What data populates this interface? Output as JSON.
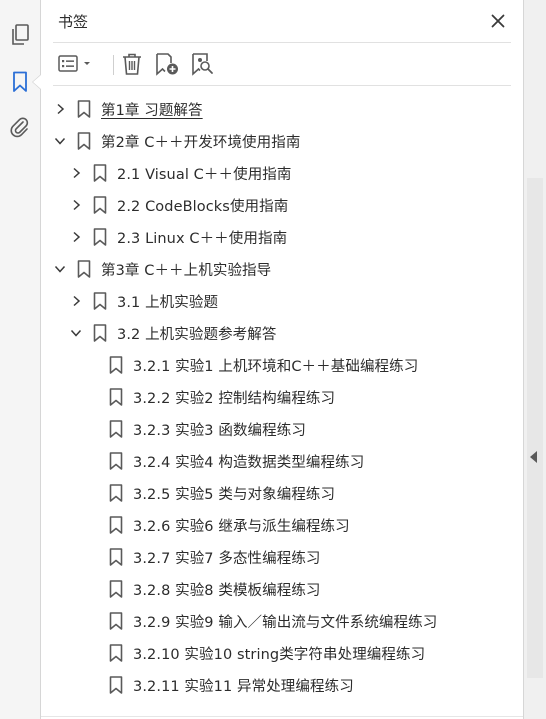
{
  "panel": {
    "title": "书签"
  },
  "rail": {
    "icons": [
      "pages-icon",
      "bookmark-icon",
      "attachment-icon"
    ]
  },
  "toolbar": {
    "buttons": [
      "options-menu-icon",
      "delete-bookmark-icon",
      "new-bookmark-icon",
      "bookmark-search-icon"
    ]
  },
  "bookmarks": [
    {
      "label": "第1章 习题解答",
      "level": 0,
      "state": "collapsed",
      "underline": true
    },
    {
      "label": "第2章 C＋＋开发环境使用指南",
      "level": 0,
      "state": "expanded"
    },
    {
      "label": "2.1 Visual C＋＋使用指南",
      "level": 1,
      "state": "collapsed"
    },
    {
      "label": "2.2 CodeBlocks使用指南",
      "level": 1,
      "state": "collapsed"
    },
    {
      "label": "2.3 Linux C＋＋使用指南",
      "level": 1,
      "state": "collapsed"
    },
    {
      "label": "第3章 C＋＋上机实验指导",
      "level": 0,
      "state": "expanded"
    },
    {
      "label": "3.1 上机实验题",
      "level": 1,
      "state": "collapsed"
    },
    {
      "label": "3.2 上机实验题参考解答",
      "level": 1,
      "state": "expanded"
    },
    {
      "label": "3.2.1 实验1 上机环境和C＋＋基础编程练习",
      "level": 2,
      "state": "leaf"
    },
    {
      "label": "3.2.2 实验2 控制结构编程练习",
      "level": 2,
      "state": "leaf"
    },
    {
      "label": "3.2.3 实验3 函数编程练习",
      "level": 2,
      "state": "leaf"
    },
    {
      "label": "3.2.4 实验4 构造数据类型编程练习",
      "level": 2,
      "state": "leaf"
    },
    {
      "label": "3.2.5 实验5 类与对象编程练习",
      "level": 2,
      "state": "leaf"
    },
    {
      "label": "3.2.6 实验6 继承与派生编程练习",
      "level": 2,
      "state": "leaf"
    },
    {
      "label": "3.2.7 实验7 多态性编程练习",
      "level": 2,
      "state": "leaf"
    },
    {
      "label": "3.2.8 实验8 类模板编程练习",
      "level": 2,
      "state": "leaf"
    },
    {
      "label": "3.2.9 实验9 输入／输出流与文件系统编程练习",
      "level": 2,
      "state": "leaf"
    },
    {
      "label": "3.2.10 实验10 string类字符串处理编程练习",
      "level": 2,
      "state": "leaf"
    },
    {
      "label": "3.2.11 实验11 异常处理编程练习",
      "level": 2,
      "state": "leaf"
    }
  ],
  "colors": {
    "icon": "#5a5a5a",
    "active_icon": "#2b6fd6",
    "text": "#2c2c2c"
  }
}
